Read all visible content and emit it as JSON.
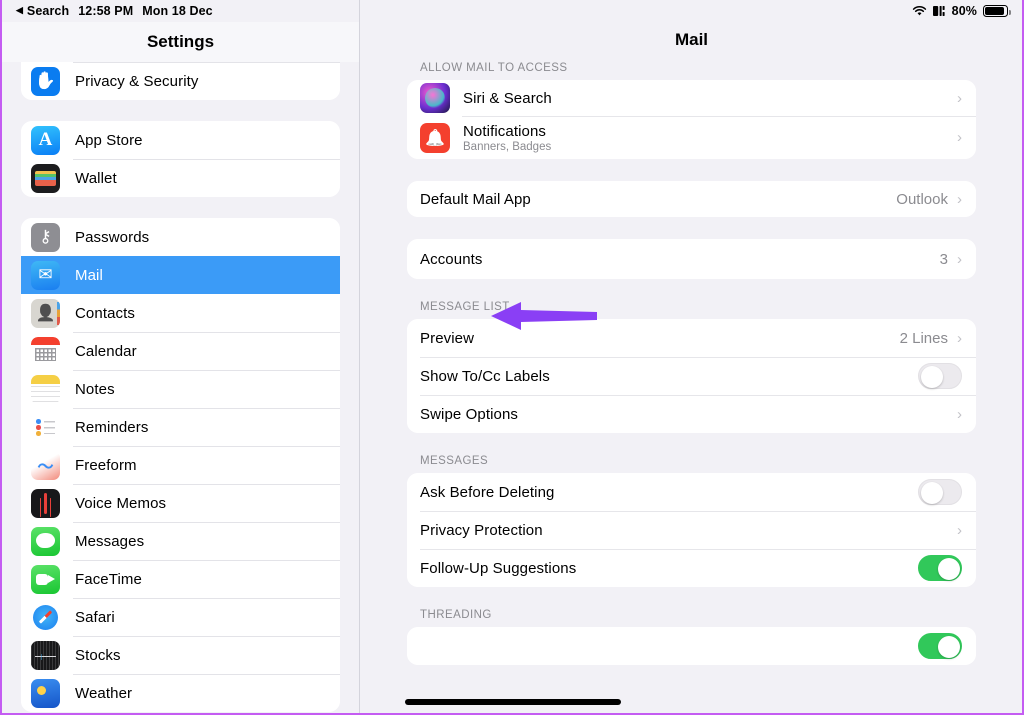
{
  "status_bar": {
    "back_label": "Search",
    "time": "12:58 PM",
    "date": "Mon 18 Dec",
    "battery_percent": "80%",
    "wifi_icon": "wifi-icon",
    "cellular_icon": "cellular-signal-icon",
    "battery_icon": "battery-icon"
  },
  "sidebar": {
    "title": "Settings",
    "groups": [
      {
        "items": [
          {
            "label": "",
            "icon": "health-icon",
            "clipped": true
          },
          {
            "label": "Privacy & Security",
            "icon": "privacy-hand-icon"
          }
        ]
      },
      {
        "items": [
          {
            "label": "App Store",
            "icon": "app-store-icon"
          },
          {
            "label": "Wallet",
            "icon": "wallet-icon"
          }
        ]
      },
      {
        "items": [
          {
            "label": "Passwords",
            "icon": "passwords-key-icon"
          },
          {
            "label": "Mail",
            "icon": "mail-envelope-icon",
            "selected": true
          },
          {
            "label": "Contacts",
            "icon": "contacts-icon"
          },
          {
            "label": "Calendar",
            "icon": "calendar-icon"
          },
          {
            "label": "Notes",
            "icon": "notes-icon"
          },
          {
            "label": "Reminders",
            "icon": "reminders-icon"
          },
          {
            "label": "Freeform",
            "icon": "freeform-icon"
          },
          {
            "label": "Voice Memos",
            "icon": "voice-memos-icon"
          },
          {
            "label": "Messages",
            "icon": "messages-icon"
          },
          {
            "label": "FaceTime",
            "icon": "facetime-icon"
          },
          {
            "label": "Safari",
            "icon": "safari-icon"
          },
          {
            "label": "Stocks",
            "icon": "stocks-icon"
          },
          {
            "label": "Weather",
            "icon": "weather-icon"
          }
        ]
      }
    ]
  },
  "main": {
    "title": "Mail",
    "sections": [
      {
        "header": "ALLOW MAIL TO ACCESS",
        "rows": [
          {
            "label": "Siri & Search",
            "icon": "siri-icon",
            "control": "chevron",
            "chevron": "›"
          },
          {
            "label": "Notifications",
            "sub": "Banners, Badges",
            "icon": "notifications-bell-icon",
            "control": "chevron",
            "chevron": "›"
          }
        ]
      },
      {
        "header": "",
        "rows": [
          {
            "label": "Default Mail App",
            "value": "Outlook",
            "control": "chevron",
            "chevron": "›"
          }
        ]
      },
      {
        "header": "",
        "rows": [
          {
            "label": "Accounts",
            "value": "3",
            "control": "chevron",
            "chevron": "›"
          }
        ]
      },
      {
        "header": "MESSAGE LIST",
        "rows": [
          {
            "label": "Preview",
            "value": "2 Lines",
            "control": "chevron",
            "chevron": "›"
          },
          {
            "label": "Show To/Cc Labels",
            "control": "toggle",
            "toggle_on": false
          },
          {
            "label": "Swipe Options",
            "control": "chevron",
            "chevron": "›"
          }
        ]
      },
      {
        "header": "MESSAGES",
        "rows": [
          {
            "label": "Ask Before Deleting",
            "control": "toggle",
            "toggle_on": false
          },
          {
            "label": "Privacy Protection",
            "control": "chevron",
            "chevron": "›"
          },
          {
            "label": "Follow-Up Suggestions",
            "control": "toggle",
            "toggle_on": true
          }
        ]
      },
      {
        "header": "THREADING",
        "rows": [
          {
            "label": "",
            "control": "toggle",
            "toggle_on": true
          }
        ]
      }
    ]
  },
  "annotation": {
    "arrow_color": "#8a3ff5",
    "points_at": "Accounts"
  },
  "colors": {
    "selection_blue": "#3b9bf7",
    "toggle_green": "#31c85a",
    "background": "#f2f1f6",
    "card": "#ffffff",
    "frame_border": "#c45cf2"
  }
}
